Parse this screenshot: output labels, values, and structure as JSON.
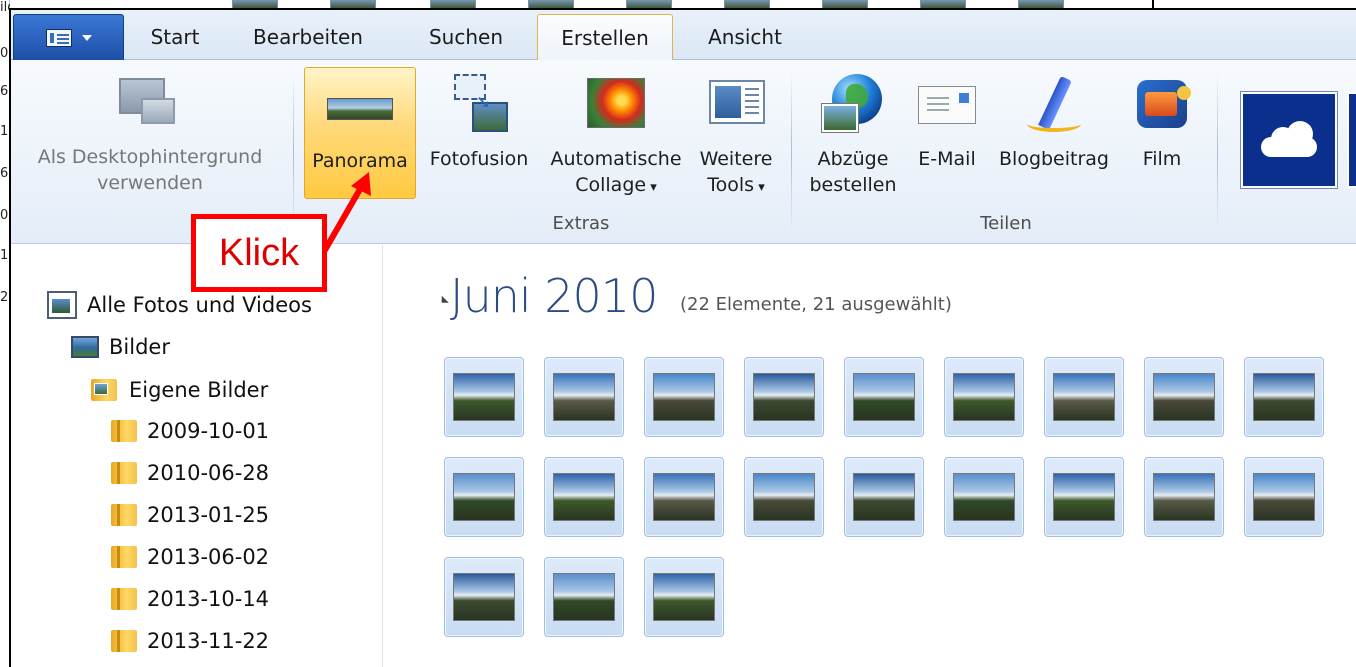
{
  "window": {
    "left_edge_chars": [
      "ilder",
      "0",
      "6",
      "1",
      "6",
      "0",
      "1",
      "2"
    ]
  },
  "tabs": [
    {
      "label": "Start"
    },
    {
      "label": "Bearbeiten"
    },
    {
      "label": "Suchen"
    },
    {
      "label": "Erstellen",
      "active": true
    },
    {
      "label": "Ansicht"
    }
  ],
  "ribbon": {
    "desktop": {
      "label_line1": "Als Desktophintergrund",
      "label_line2": "verwenden",
      "icon": "desktop-background-icon"
    },
    "extras": {
      "group_label": "Extras",
      "panorama": {
        "label": "Panorama",
        "icon": "panorama-icon"
      },
      "fotofusion": {
        "label": "Fotofusion",
        "icon": "photo-fuse-icon"
      },
      "collage": {
        "label_line1": "Automatische",
        "label_line2": "Collage",
        "icon": "collage-icon"
      },
      "tools": {
        "label_line1": "Weitere",
        "label_line2": "Tools",
        "icon": "more-tools-icon"
      }
    },
    "share": {
      "group_label": "Teilen",
      "prints": {
        "label_line1": "Abzüge",
        "label_line2": "bestellen",
        "icon": "order-prints-icon"
      },
      "email": {
        "label": "E-Mail",
        "icon": "email-icon"
      },
      "blog": {
        "label": "Blogbeitrag",
        "icon": "blog-icon"
      },
      "film": {
        "label": "Film",
        "icon": "movie-icon"
      }
    },
    "cloud": {
      "icon": "onedrive-cloud-icon"
    }
  },
  "annotation": {
    "text": "Klick",
    "color": "#ff0000"
  },
  "sidebar": {
    "items": [
      {
        "label": "Alle Fotos und Videos",
        "icon": "all-photos-icon"
      },
      {
        "label": "Bilder",
        "icon": "pictures-icon"
      },
      {
        "label": "Eigene Bilder",
        "icon": "my-pictures-icon"
      },
      {
        "label": "2009-10-01",
        "icon": "folder-icon"
      },
      {
        "label": "2010-06-28",
        "icon": "folder-icon"
      },
      {
        "label": "2013-01-25",
        "icon": "folder-icon"
      },
      {
        "label": "2013-06-02",
        "icon": "folder-icon"
      },
      {
        "label": "2013-10-14",
        "icon": "folder-icon"
      },
      {
        "label": "2013-11-22",
        "icon": "folder-icon"
      }
    ]
  },
  "content": {
    "group_title": "Juni 2010",
    "group_subtitle": "(22 Elemente, 21 ausgewählt)",
    "thumbnail_count": 21,
    "colors": {
      "accent_title": "#2b4d84",
      "selection_border": "#9fbfe3",
      "selection_fill": "#d3e3f7"
    }
  }
}
